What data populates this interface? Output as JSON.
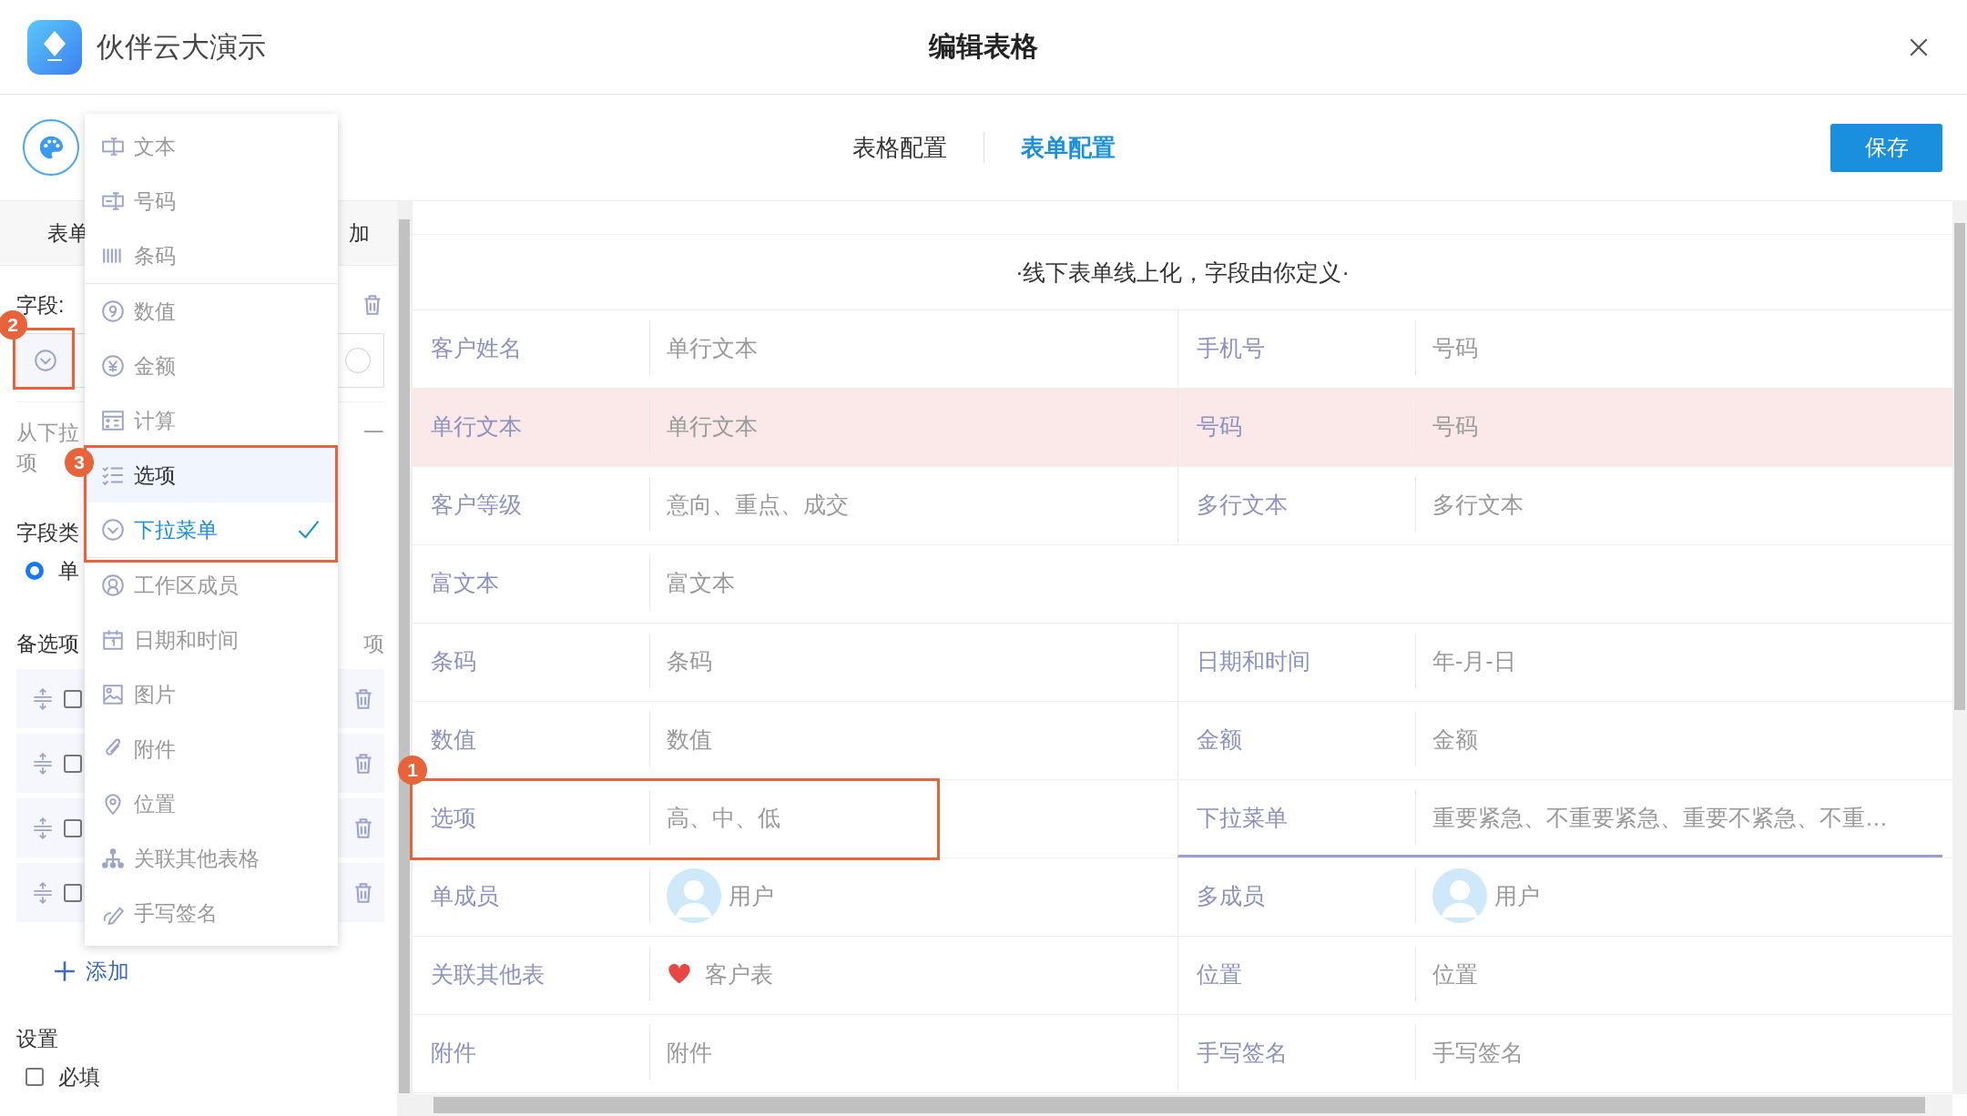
{
  "window": {
    "app_name": "伙伴云大演示",
    "title": "编辑表格"
  },
  "tabs": [
    {
      "label": "表格配置",
      "selected": false
    },
    {
      "label": "表单配置",
      "selected": true
    }
  ],
  "save_button": "保存",
  "left_panel": {
    "tab_fragments": [
      "表单",
      "加"
    ],
    "field_label": "字段:",
    "field_select": {
      "callout": "2"
    },
    "hint_start": "从下拉",
    "hint_end": "一",
    "hint_line2": "项",
    "type_label": "字段类",
    "radio": {
      "label": "单",
      "checked": true
    },
    "options_label": "备选项",
    "options_label_end": "项",
    "option_rows": [
      {
        "checked": false
      },
      {
        "checked": false
      },
      {
        "checked": false
      },
      {
        "checked": false
      }
    ],
    "add": "添加",
    "settings_label": "设置",
    "required": {
      "label": "必填",
      "checked": false
    }
  },
  "menu": [
    {
      "kind": "text",
      "label": "文本",
      "hovered": false,
      "selected": false,
      "divider": false
    },
    {
      "kind": "phone",
      "label": "号码",
      "hovered": false,
      "selected": false,
      "divider": false
    },
    {
      "kind": "barcode",
      "label": "条码",
      "hovered": false,
      "selected": false,
      "divider": true
    },
    {
      "kind": "number",
      "label": "数值",
      "hovered": false,
      "selected": false,
      "divider": false
    },
    {
      "kind": "money",
      "label": "金额",
      "hovered": false,
      "selected": false,
      "divider": false
    },
    {
      "kind": "formula",
      "label": "计算",
      "hovered": false,
      "selected": false,
      "divider": false
    },
    {
      "kind": "options",
      "label": "选项",
      "hovered": true,
      "selected": false,
      "divider": false,
      "callout": "3"
    },
    {
      "kind": "dropdown",
      "label": "下拉菜单",
      "hovered": false,
      "selected": true,
      "divider": true
    },
    {
      "kind": "member",
      "label": "工作区成员",
      "hovered": false,
      "selected": false,
      "divider": false
    },
    {
      "kind": "date",
      "label": "日期和时间",
      "hovered": false,
      "selected": false,
      "divider": false
    },
    {
      "kind": "image",
      "label": "图片",
      "hovered": false,
      "selected": false,
      "divider": false
    },
    {
      "kind": "attachment",
      "label": "附件",
      "hovered": false,
      "selected": false,
      "divider": false
    },
    {
      "kind": "location",
      "label": "位置",
      "hovered": false,
      "selected": false,
      "divider": false
    },
    {
      "kind": "relation",
      "label": "关联其他表格",
      "hovered": false,
      "selected": false,
      "divider": false
    },
    {
      "kind": "signature",
      "label": "手写签名",
      "hovered": false,
      "selected": false,
      "divider": false
    }
  ],
  "form": {
    "heading": "·线下表单线上化，字段由你定义·",
    "rows": [
      {
        "highlighted": false,
        "cells": [
          {
            "label": "客户姓名",
            "value": "单行文本",
            "kind": "text",
            "active": false
          },
          {
            "label": "手机号",
            "value": "号码",
            "kind": "text",
            "active": false
          }
        ]
      },
      {
        "highlighted": true,
        "cells": [
          {
            "label": "单行文本",
            "value": "单行文本",
            "kind": "text",
            "active": false
          },
          {
            "label": "号码",
            "value": "号码",
            "kind": "text",
            "active": false
          }
        ]
      },
      {
        "highlighted": false,
        "cells": [
          {
            "label": "客户等级",
            "value": "意向、重点、成交",
            "kind": "text",
            "active": false
          },
          {
            "label": "多行文本",
            "value": "多行文本",
            "kind": "text",
            "active": false
          }
        ]
      },
      {
        "highlighted": false,
        "cells": [
          {
            "label": "富文本",
            "value": "富文本",
            "kind": "text",
            "active": false
          }
        ]
      },
      {
        "highlighted": false,
        "cells": [
          {
            "label": "条码",
            "value": "条码",
            "kind": "text",
            "active": false
          },
          {
            "label": "日期和时间",
            "value": "年-月-日",
            "kind": "text",
            "active": false
          }
        ]
      },
      {
        "highlighted": false,
        "cells": [
          {
            "label": "数值",
            "value": "数值",
            "kind": "text",
            "active": false
          },
          {
            "label": "金额",
            "value": "金额",
            "kind": "text",
            "active": false
          }
        ]
      },
      {
        "highlighted": false,
        "cells": [
          {
            "label": "选项",
            "value": "高、中、低",
            "kind": "text",
            "active": false,
            "callout": "1"
          },
          {
            "label": "下拉菜单",
            "value": "重要紧急、不重要紧急、重要不紧急、不重…",
            "kind": "text",
            "active": true
          }
        ]
      },
      {
        "highlighted": false,
        "cells": [
          {
            "label": "单成员",
            "value": "用户",
            "kind": "user",
            "active": false
          },
          {
            "label": "多成员",
            "value": "用户",
            "kind": "user",
            "active": false
          }
        ]
      },
      {
        "highlighted": false,
        "cells": [
          {
            "label": "关联其他表",
            "value": "客户表",
            "kind": "relation",
            "active": false
          },
          {
            "label": "位置",
            "value": "位置",
            "kind": "text",
            "active": false
          }
        ]
      },
      {
        "highlighted": false,
        "cells": [
          {
            "label": "附件",
            "value": "附件",
            "kind": "text",
            "active": false
          },
          {
            "label": "手写签名",
            "value": "手写签名",
            "kind": "text",
            "active": false
          }
        ]
      }
    ]
  }
}
